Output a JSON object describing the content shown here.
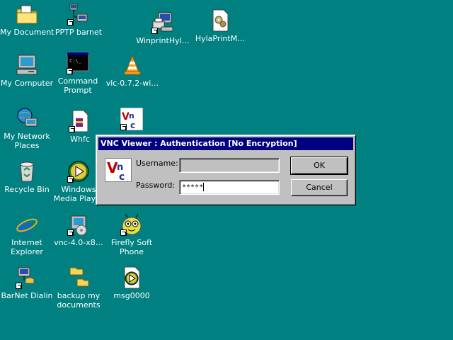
{
  "desktop": {
    "icons": [
      {
        "label": "My Documents",
        "label2": "",
        "icon": "my-documents-folder-icon"
      },
      {
        "label": "PPTP barnet",
        "label2": "",
        "icon": "network-connection-icon"
      },
      {
        "label": "WinprintHyl…",
        "label2": "",
        "icon": "printer-computer-icon"
      },
      {
        "label": "HylaPrintM…",
        "label2": "",
        "icon": "gear-document-icon"
      },
      {
        "label": "My Computer",
        "label2": "",
        "icon": "my-computer-icon"
      },
      {
        "label": "Command",
        "label2": "Prompt",
        "icon": "command-prompt-icon"
      },
      {
        "label": "vlc-0.7.2-wi…",
        "label2": "",
        "icon": "vlc-cone-icon"
      },
      {
        "label": "My Network",
        "label2": "Places",
        "icon": "network-places-icon"
      },
      {
        "label": "Whfc",
        "label2": "",
        "icon": "winrar-document-icon"
      },
      {
        "label": "",
        "label2": "",
        "icon": "vnc-viewer-icon"
      },
      {
        "label": "Recycle Bin",
        "label2": "",
        "icon": "recycle-bin-icon"
      },
      {
        "label": "Windows",
        "label2": "Media Player",
        "icon": "media-player-icon"
      },
      {
        "label": "Internet",
        "label2": "Explorer",
        "icon": "internet-explorer-icon"
      },
      {
        "label": "vnc-4.0-x8…",
        "label2": "",
        "icon": "vnc-installer-icon"
      },
      {
        "label": "Firefly Soft",
        "label2": "Phone",
        "icon": "firefly-bug-icon"
      },
      {
        "label": "BarNet Dialin",
        "label2": "",
        "icon": "dialup-icon"
      },
      {
        "label": "backup my",
        "label2": "documents",
        "icon": "folder-icon"
      },
      {
        "label": "msg0000",
        "label2": "",
        "icon": "media-file-icon"
      }
    ]
  },
  "dialog": {
    "title": "VNC Viewer : Authentication [No Encryption]",
    "logo_text": "VNC",
    "username_label": "Username:",
    "username_value": "",
    "password_label": "Password:",
    "password_value": "*****",
    "ok_label": "OK",
    "cancel_label": "Cancel"
  },
  "colors": {
    "desktop_bg": "#008080",
    "titlebar_bg": "#000080",
    "dialog_bg": "#c0c0c0"
  }
}
